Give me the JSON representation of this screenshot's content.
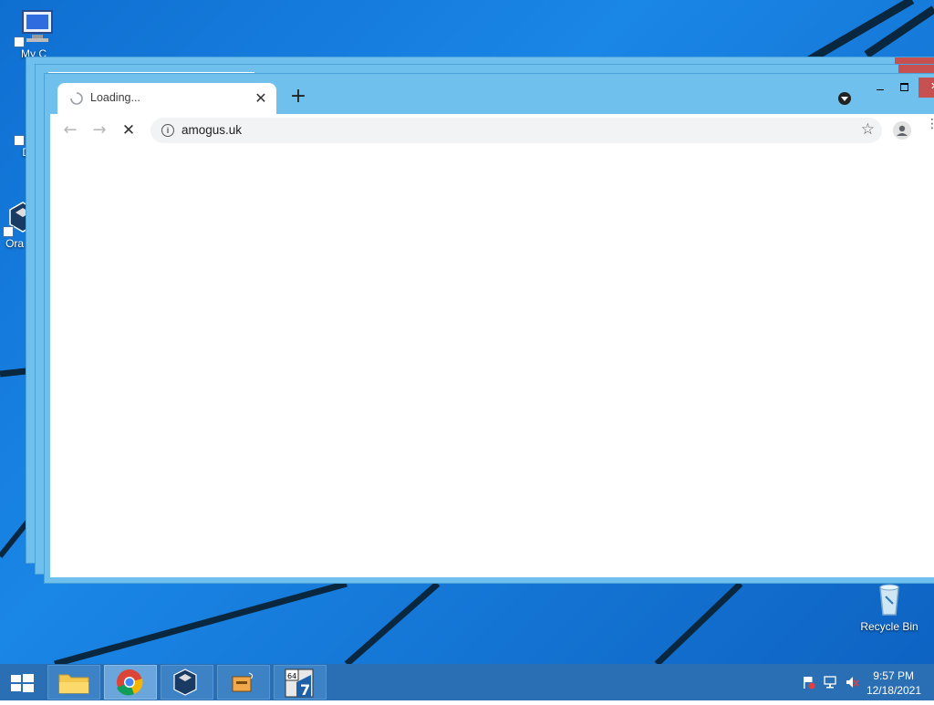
{
  "desktop": {
    "icons": [
      {
        "label": "My C",
        "icon": "computer-icon"
      },
      {
        "label": "Data",
        "icon": "database-icon"
      },
      {
        "label": "Ora Vir",
        "icon": "virtualbox-icon"
      },
      {
        "label": "Recycle Bin",
        "icon": "recycle-bin-icon"
      }
    ]
  },
  "browser": {
    "tab": {
      "title": "Loading...",
      "close_glyph": "✕"
    },
    "new_tab_glyph": "+",
    "toolbar": {
      "back_glyph": "←",
      "forward_glyph": "→",
      "stop_glyph": "✕",
      "url": "amogus.uk",
      "info_glyph": "i",
      "star_glyph": "☆",
      "menu_glyph": "⋮"
    },
    "colors": {
      "frame": "#6fc0ec",
      "close_button": "#c75050"
    }
  },
  "taskbar": {
    "apps": [
      {
        "name": "file-explorer",
        "icon": "folder-icon"
      },
      {
        "name": "chrome",
        "icon": "chrome-icon",
        "active": true
      },
      {
        "name": "virtualbox",
        "icon": "virtualbox-icon"
      },
      {
        "name": "app",
        "icon": "toolbox-icon"
      },
      {
        "name": "seven-zip",
        "icon": "seven-zip-icon"
      }
    ],
    "clock": {
      "time": "9:57 PM",
      "date": "12/18/2021"
    }
  }
}
